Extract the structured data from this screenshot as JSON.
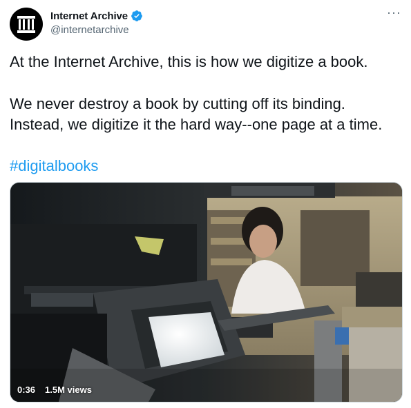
{
  "tweet": {
    "author": {
      "display_name": "Internet Archive",
      "handle": "@internetarchive",
      "verified": true
    },
    "more_label": "···",
    "text": {
      "line1": "At the Internet Archive, this is how we digitize a book.",
      "line2": "We never destroy a book by cutting off its binding.",
      "line3": "Instead, we digitize it the hard way--one page at a time.",
      "hashtag": "#digitalbooks"
    },
    "video": {
      "duration": "0:36",
      "views": "1.5M views"
    }
  },
  "colors": {
    "link": "#1d9bf0",
    "verified": "#1d9bf0",
    "secondary_text": "#536471"
  },
  "icons": {
    "avatar": "archive-building-icon",
    "verified": "verified-badge-icon",
    "more": "more-options-icon"
  }
}
